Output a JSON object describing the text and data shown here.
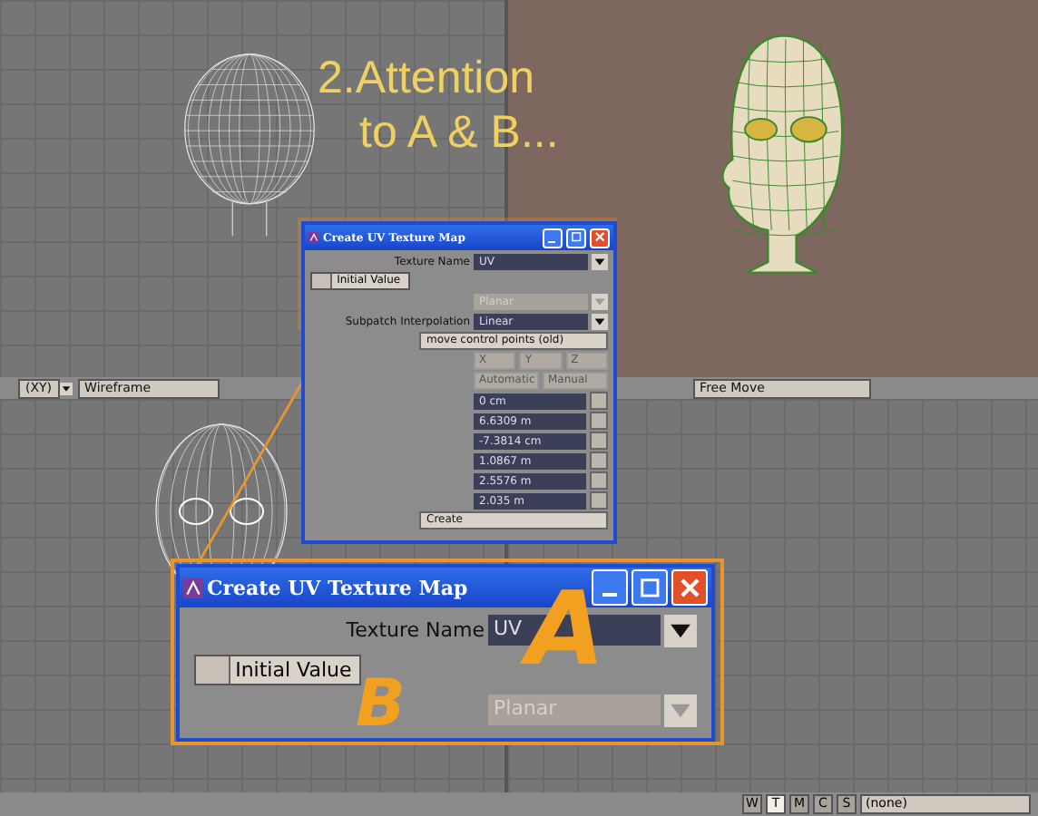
{
  "caption": {
    "lines": [
      "2.Attention",
      "to A & B..."
    ]
  },
  "viewport_bar": {
    "view": "(XY)",
    "shading": "Wireframe",
    "tool": "Free Move"
  },
  "dialogs": [
    {
      "zoomed": false,
      "title": "Create UV Texture Map",
      "rows": [
        {
          "kind": "select",
          "label": "Texture Name",
          "value": "UV",
          "disabled": false
        },
        {
          "kind": "toggle",
          "label": "Initial Value",
          "checked": false
        },
        {
          "kind": "select",
          "value": "Planar",
          "disabled": true
        },
        {
          "kind": "select",
          "label": "Subpatch Interpolation",
          "value": "Linear",
          "disabled": false
        },
        {
          "kind": "button",
          "label": "move control points (old)"
        },
        {
          "kind": "choices",
          "values": [
            "X",
            "Y",
            "Z"
          ],
          "disabled": true
        },
        {
          "kind": "choices",
          "values": [
            "Automatic",
            "Manual"
          ],
          "disabled": true
        },
        {
          "kind": "number",
          "value": "0 cm"
        },
        {
          "kind": "number",
          "value": "6.6309 m"
        },
        {
          "kind": "number",
          "value": "-7.3814 cm"
        },
        {
          "kind": "number",
          "value": "1.0867 m"
        },
        {
          "kind": "number",
          "value": "2.5576 m"
        },
        {
          "kind": "number",
          "value": "2.035 m"
        },
        {
          "kind": "button",
          "label": "Create"
        }
      ]
    },
    {
      "zoomed": true,
      "title": "Create UV Texture Map",
      "rows": [
        {
          "kind": "select",
          "label": "Texture Name",
          "value": "UV",
          "disabled": false
        },
        {
          "kind": "toggle",
          "label": "Initial Value",
          "checked": false
        },
        {
          "kind": "select",
          "value": "Planar",
          "disabled": true
        }
      ]
    }
  ],
  "markers": [
    "A",
    "B"
  ],
  "status_bar": {
    "buttons": [
      {
        "label": "W",
        "selected": false
      },
      {
        "label": "T",
        "selected": true
      },
      {
        "label": "M",
        "selected": false
      },
      {
        "label": "C",
        "selected": false
      },
      {
        "label": "S",
        "selected": false
      }
    ],
    "surface": "(none)"
  }
}
